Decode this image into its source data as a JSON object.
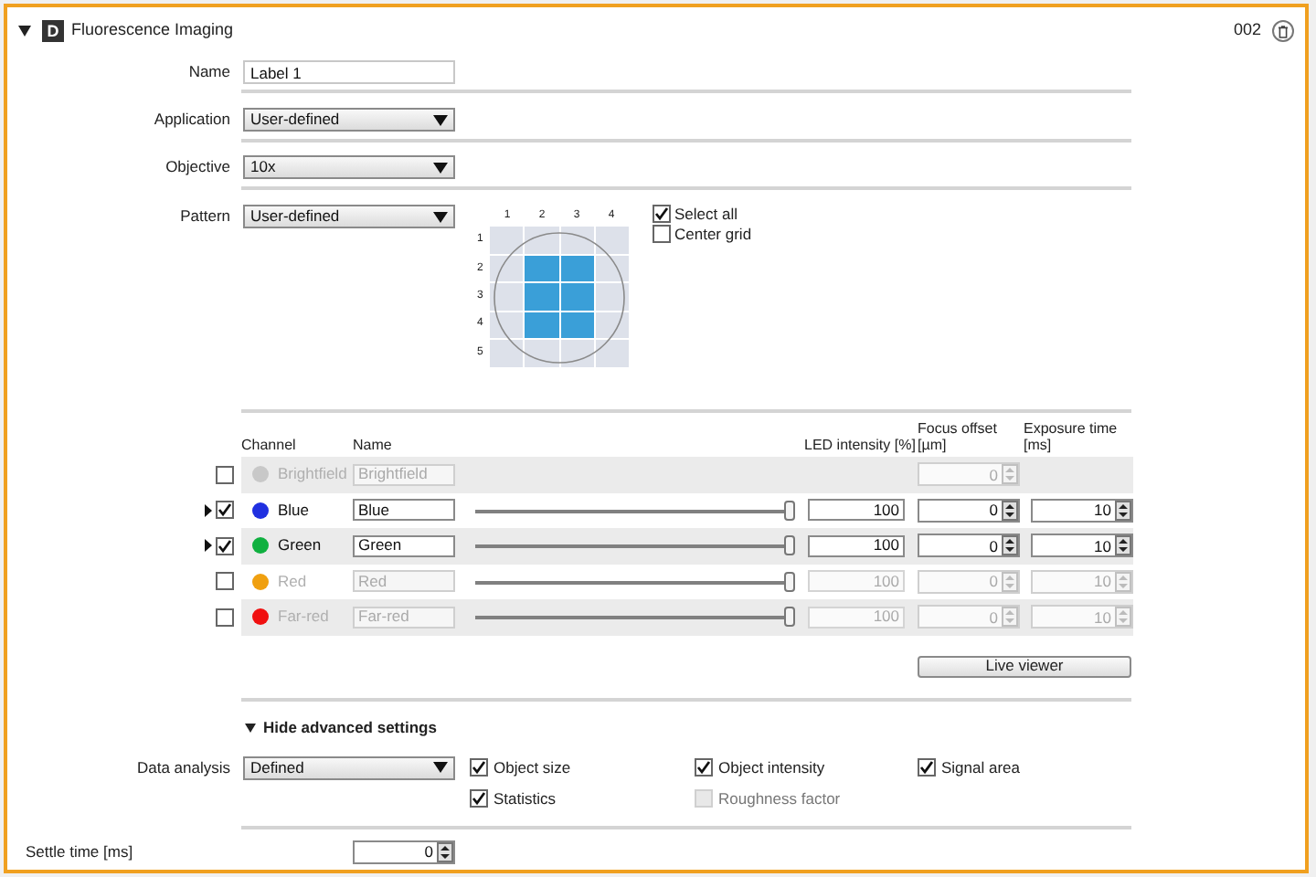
{
  "header": {
    "expanded": true,
    "badge": "D",
    "title": "Fluorescence Imaging",
    "number": "002"
  },
  "fields": [
    {
      "kind": "text",
      "label": "Name",
      "value": "Label 1"
    },
    {
      "kind": "select",
      "label": "Application",
      "value": "User-defined"
    },
    {
      "kind": "select",
      "label": "Objective",
      "value": "10x"
    }
  ],
  "pattern": {
    "label": "Pattern",
    "value": "User-defined",
    "columns": [
      "1",
      "2",
      "3",
      "4"
    ],
    "rows": [
      {
        "label": "1",
        "cells": [
          {
            "selected": false
          },
          {
            "selected": false
          },
          {
            "selected": false
          },
          {
            "selected": false
          }
        ]
      },
      {
        "label": "2",
        "cells": [
          {
            "selected": false
          },
          {
            "selected": true
          },
          {
            "selected": true
          },
          {
            "selected": false
          }
        ]
      },
      {
        "label": "3",
        "cells": [
          {
            "selected": false
          },
          {
            "selected": true
          },
          {
            "selected": true
          },
          {
            "selected": false
          }
        ]
      },
      {
        "label": "4",
        "cells": [
          {
            "selected": false
          },
          {
            "selected": true
          },
          {
            "selected": true
          },
          {
            "selected": false
          }
        ]
      },
      {
        "label": "5",
        "cells": [
          {
            "selected": false
          },
          {
            "selected": false
          },
          {
            "selected": false
          },
          {
            "selected": false
          }
        ]
      }
    ],
    "options": [
      {
        "label": "Select all",
        "checked": true
      },
      {
        "label": "Center grid",
        "checked": false
      }
    ]
  },
  "channels": {
    "columns": [
      "Channel",
      "Name",
      "LED intensity [%]",
      "Focus offset [µm]",
      "Exposure time [ms]"
    ],
    "rows": [
      {
        "expandable": false,
        "checked": false,
        "disabled": true,
        "color": "#c8c8c8",
        "channel": "Brightfield",
        "name": "Brightfield",
        "focus": "0"
      },
      {
        "expandable": true,
        "checked": true,
        "disabled": false,
        "color": "#2030e0",
        "channel": "Blue",
        "name": "Blue",
        "level": 1,
        "led": "100",
        "focus": "0",
        "exposure": "10"
      },
      {
        "expandable": true,
        "checked": true,
        "disabled": false,
        "color": "#10b040",
        "channel": "Green",
        "name": "Green",
        "level": 1,
        "led": "100",
        "focus": "0",
        "exposure": "10"
      },
      {
        "expandable": false,
        "checked": false,
        "disabled": true,
        "color": "#f0a010",
        "channel": "Red",
        "name": "Red",
        "level": 1,
        "led": "100",
        "focus": "0",
        "exposure": "10"
      },
      {
        "expandable": false,
        "checked": false,
        "disabled": true,
        "color": "#f01010",
        "channel": "Far-red",
        "name": "Far-red",
        "level": 1,
        "led": "100",
        "focus": "0",
        "exposure": "10"
      }
    ]
  },
  "live_viewer": "Live viewer",
  "advanced": {
    "toggle": "Hide advanced settings",
    "expanded": true,
    "label": "Data analysis",
    "value": "Defined",
    "options": [
      {
        "label": "Object size",
        "checked": true,
        "disabled": false
      },
      {
        "label": "Object intensity",
        "checked": true,
        "disabled": false
      },
      {
        "label": "Signal area",
        "checked": true,
        "disabled": false
      },
      {
        "label": "Statistics",
        "checked": true,
        "disabled": false
      },
      {
        "label": "Roughness factor",
        "checked": false,
        "disabled": true
      }
    ]
  },
  "settle_time": {
    "label": "Settle time [ms]",
    "value": "0"
  }
}
